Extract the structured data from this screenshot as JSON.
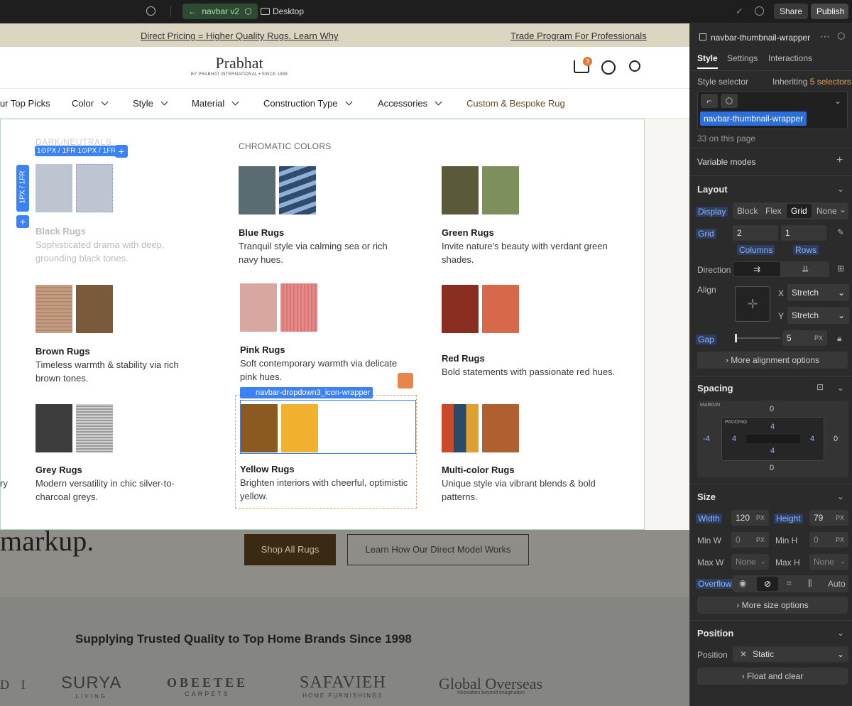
{
  "topbar": {
    "page_name": "navbar v2",
    "breakpoint": "Desktop",
    "share": "Share",
    "publish": "Publish"
  },
  "site": {
    "announce_left": "Direct Pricing = Higher Quality Rugs. Learn Why",
    "announce_right": "Trade Program For Professionals",
    "logo_main": "Prabhat",
    "logo_sub": "BY PRABHAT INTERNATIONAL • SINCE 1998",
    "cart_count": "3",
    "nav": [
      "ur Top Picks",
      "Color",
      "Style",
      "Material",
      "Construction Type",
      "Accessories",
      "Custom & Bespoke Rug"
    ],
    "dark_header": "DARK/NEUTRALS",
    "chromatic_header": "CHROMATIC COLORS",
    "grid_labels": {
      "col1": "1⊙PX / 1FR",
      "col2": "1⊙PX / 1FR",
      "row": "1PX / 1FR"
    },
    "selected_label": "navbar-dropdown3_icon-wrapper",
    "categories": [
      {
        "title": "Black Rugs",
        "desc": "Sophisticated drama with deep, grounding black tones."
      },
      {
        "title": "Blue Rugs",
        "desc": "Tranquil style via calming sea or rich navy hues."
      },
      {
        "title": "Green Rugs",
        "desc": "Invite nature's beauty with verdant green shades."
      },
      {
        "title": "Brown Rugs",
        "desc": "Timeless warmth & stability via rich brown tones."
      },
      {
        "title": "Pink Rugs",
        "desc": "Soft contemporary warmth via delicate pink hues."
      },
      {
        "title": "Red Rugs",
        "desc": "Bold statements with passionate red hues."
      },
      {
        "title": "Grey Rugs",
        "desc": "Modern versatility in chic silver-to-charcoal greys."
      },
      {
        "title": "Yellow Rugs",
        "desc": "Brighten interiors with cheerful, optimistic yellow."
      },
      {
        "title": "Multi-color Rugs",
        "desc": "Unique style via vibrant blends & bold patterns."
      }
    ],
    "hero_text": "markup.",
    "shop_all": "Shop All Rugs",
    "learn_how": "Learn How Our Direct Model Works",
    "trusted": "Supplying Trusted Quality to Top Home Brands Since 1998",
    "brands": [
      "D I",
      "SURYA",
      "LIVING",
      "OBEETEE",
      "CARPETS",
      "SAFAVIEH",
      "HOME FURNISHINGS",
      "Global Overseas",
      "Innovation beyond imagination"
    ],
    "partial_left": "ry"
  },
  "panel": {
    "element_name": "navbar-thumbnail-wrapper",
    "tabs": [
      "Style",
      "Settings",
      "Interactions"
    ],
    "style_selector": "Style selector",
    "inheriting": "Inheriting",
    "inheriting_count": "5 selectors",
    "selector_chip": "navbar-thumbnail-wrapper",
    "on_page": "33 on this page",
    "variable_modes": "Variable modes",
    "layout": "Layout",
    "display": "Display",
    "display_opts": [
      "Block",
      "Flex",
      "Grid",
      "None"
    ],
    "grid": "Grid",
    "grid_cols": "2",
    "grid_rows": "1",
    "columns": "Columns",
    "rows": "Rows",
    "direction": "Direction",
    "align": "Align",
    "align_x_label": "X",
    "align_x": "Stretch",
    "align_y_label": "Y",
    "align_y": "Stretch",
    "gap": "Gap",
    "gap_value": "5",
    "gap_unit": "PX",
    "more_align": "More alignment options",
    "spacing": "Spacing",
    "margin_label": "MARGIN",
    "padding_label": "PADDING",
    "margin": {
      "top": "0",
      "right": "0",
      "bottom": "0",
      "left": "-4"
    },
    "padding": {
      "top": "4",
      "right": "4",
      "bottom": "4",
      "left": "4"
    },
    "size": "Size",
    "width_label": "Width",
    "width": "120",
    "height_label": "Height",
    "height": "79",
    "px": "PX",
    "min_w": "Min W",
    "min_w_val": "0",
    "min_h": "Min H",
    "min_h_val": "0",
    "max_w": "Max W",
    "max_w_val": "None",
    "max_h": "Max H",
    "max_h_val": "None",
    "overflow": "Overflow",
    "overflow_auto": "Auto",
    "more_size": "More size options",
    "position": "Position",
    "position_label": "Position",
    "position_val": "Static",
    "float_clear": "Float and clear"
  }
}
